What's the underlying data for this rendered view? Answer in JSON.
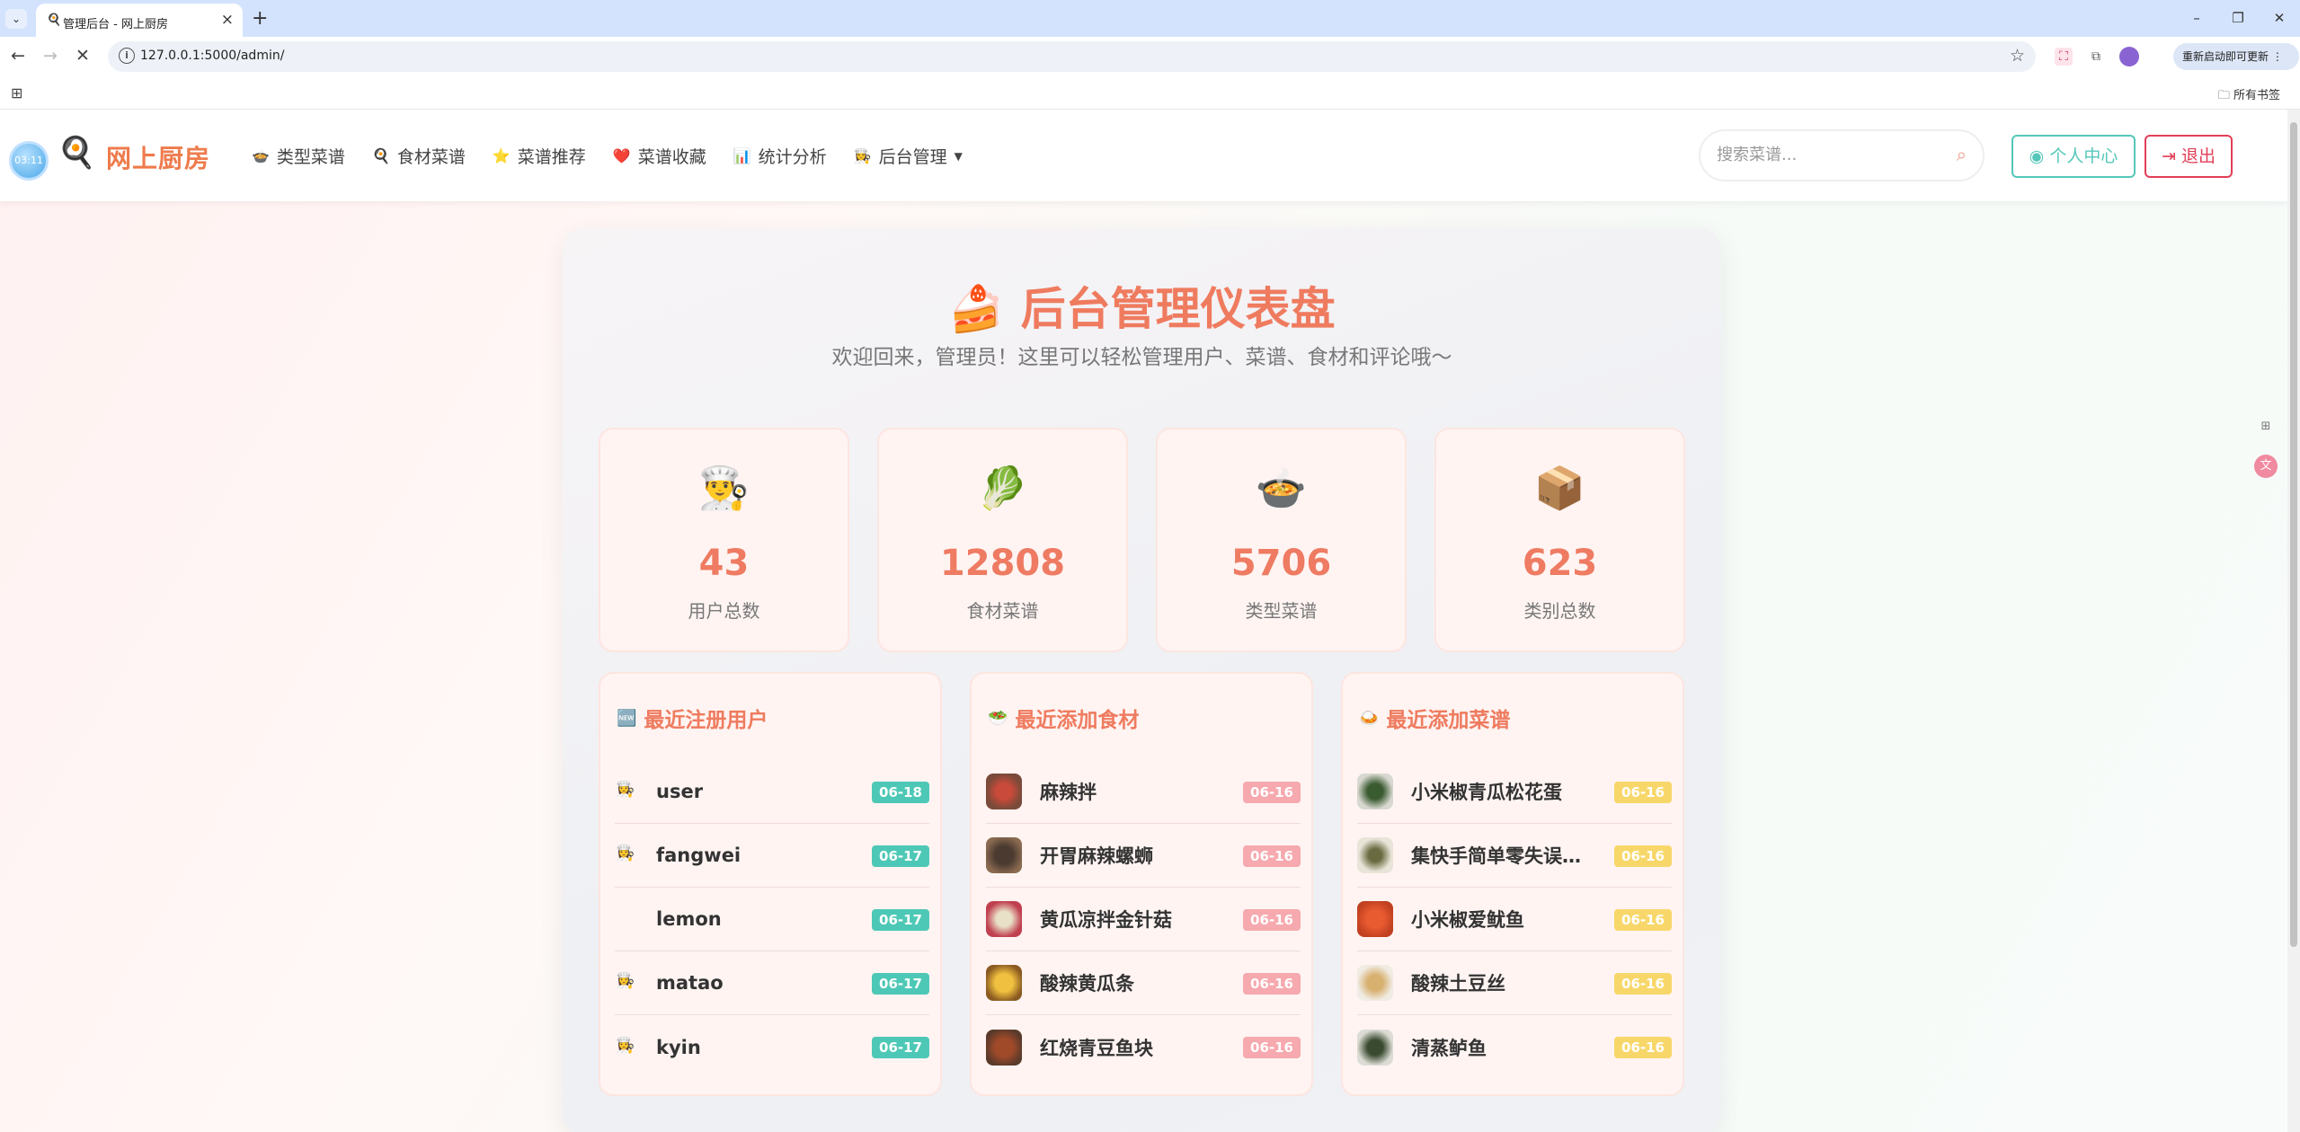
{
  "browser": {
    "tab_title": "管理后台 - 网上厨房",
    "url": "127.0.0.1:5000/admin/",
    "update_label": "重新启动即可更新",
    "bookmarks_label": "所有书签"
  },
  "navbar": {
    "clock": "03:11",
    "brand": "网上厨房",
    "menu": [
      {
        "icon": "🍲",
        "label": "类型菜谱"
      },
      {
        "icon": "🍳",
        "label": "食材菜谱"
      },
      {
        "icon": "⭐",
        "label": "菜谱推荐"
      },
      {
        "icon": "❤️",
        "label": "菜谱收藏"
      },
      {
        "icon": "📊",
        "label": "统计分析"
      },
      {
        "icon": "👩‍🍳",
        "label": "后台管理"
      }
    ],
    "search_placeholder": "搜索菜谱...",
    "profile_label": "个人中心",
    "logout_label": "退出"
  },
  "dashboard": {
    "title_icon": "🍰",
    "title": "后台管理仪表盘",
    "subtitle": "欢迎回来，管理员！这里可以轻松管理用户、菜谱、食材和评论哦～",
    "stats": [
      {
        "icon": "👨‍🍳",
        "value": "43",
        "label": "用户总数"
      },
      {
        "icon": "🥬",
        "value": "12808",
        "label": "食材菜谱"
      },
      {
        "icon": "🍲",
        "value": "5706",
        "label": "类型菜谱"
      },
      {
        "icon": "📦",
        "value": "623",
        "label": "类别总数"
      }
    ],
    "recent_users": {
      "icon": "🆕",
      "title": "最近注册用户",
      "items": [
        {
          "name": "user",
          "date": "06-18"
        },
        {
          "name": "fangwei",
          "date": "06-17"
        },
        {
          "name": "lemon",
          "date": "06-17"
        },
        {
          "name": "matao",
          "date": "06-17"
        },
        {
          "name": "kyin",
          "date": "06-17"
        }
      ]
    },
    "recent_ingredients": {
      "icon": "🥗",
      "title": "最近添加食材",
      "items": [
        {
          "name": "麻辣拌",
          "date": "06-16"
        },
        {
          "name": "开胃麻辣螺蛳",
          "date": "06-16"
        },
        {
          "name": "黄瓜凉拌金针菇",
          "date": "06-16"
        },
        {
          "name": "酸辣黄瓜条",
          "date": "06-16"
        },
        {
          "name": "红烧青豆鱼块",
          "date": "06-16"
        }
      ]
    },
    "recent_recipes": {
      "icon": "🍛",
      "title": "最近添加菜谱",
      "items": [
        {
          "name": "小米椒青瓜松花蛋",
          "date": "06-16"
        },
        {
          "name": "集快手简单零失误下…",
          "date": "06-16"
        },
        {
          "name": "小米椒爱鱿鱼",
          "date": "06-16"
        },
        {
          "name": "酸辣土豆丝",
          "date": "06-16"
        },
        {
          "name": "清蒸鲈鱼",
          "date": "06-16"
        }
      ]
    }
  }
}
